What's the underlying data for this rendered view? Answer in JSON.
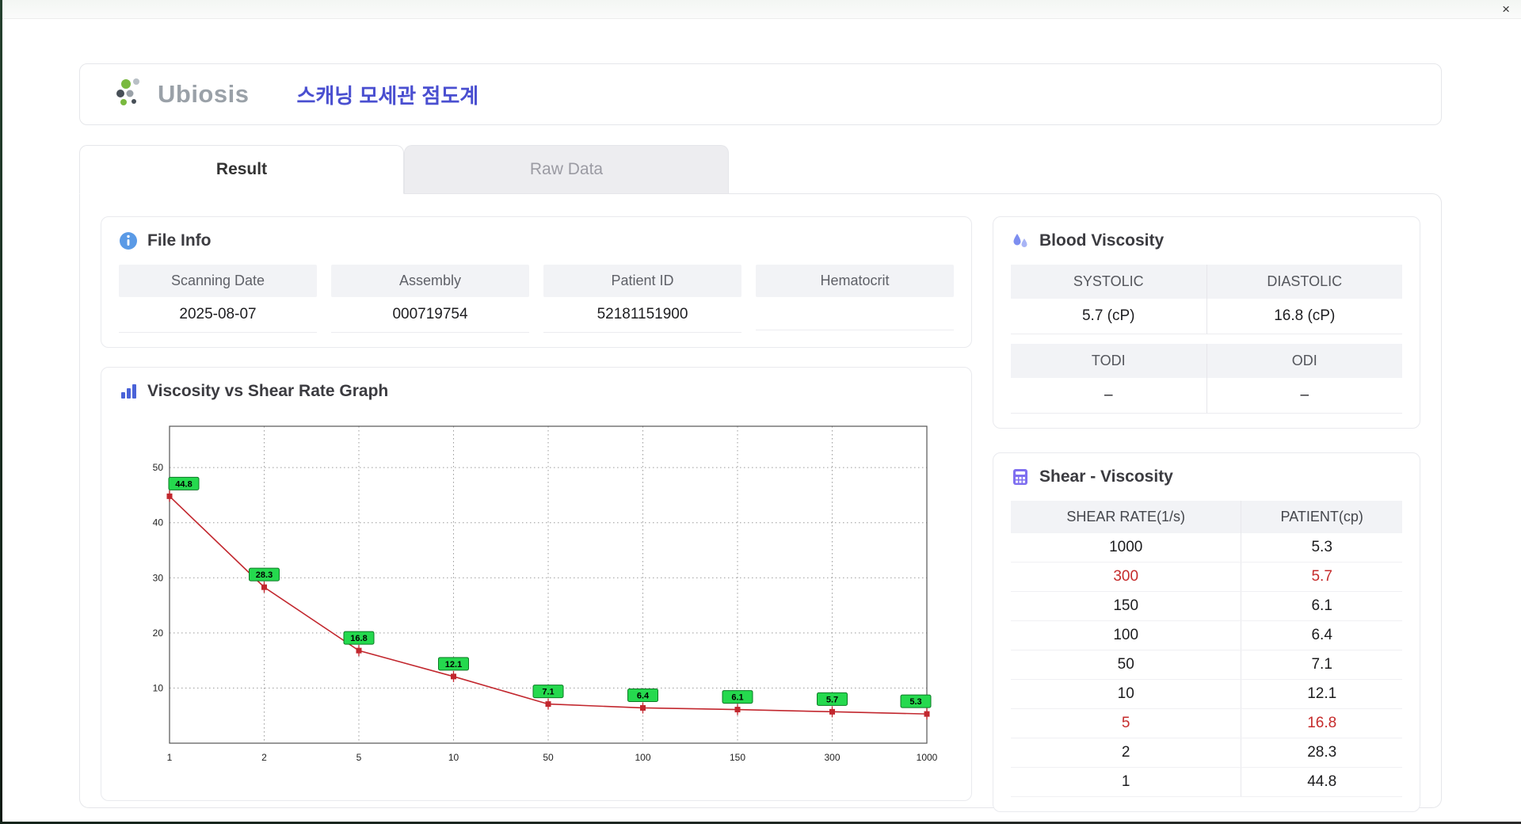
{
  "window": {
    "close_label": "×"
  },
  "header": {
    "logo_text": "Ubiosis",
    "title": "스캐닝 모세관 점도계"
  },
  "tabs": [
    {
      "label": "Result",
      "active": true
    },
    {
      "label": "Raw Data",
      "active": false
    }
  ],
  "file_info": {
    "title": "File Info",
    "fields": [
      {
        "label": "Scanning Date",
        "value": "2025-08-07"
      },
      {
        "label": "Assembly",
        "value": "000719754"
      },
      {
        "label": "Patient ID",
        "value": "52181151900"
      },
      {
        "label": "Hematocrit",
        "value": ""
      }
    ]
  },
  "blood_viscosity": {
    "title": "Blood Viscosity",
    "rows": [
      {
        "labels": [
          "SYSTOLIC",
          "DIASTOLIC"
        ],
        "values": [
          "5.7 (cP)",
          "16.8 (cP)"
        ]
      },
      {
        "labels": [
          "TODI",
          "ODI"
        ],
        "values": [
          "–",
          "–"
        ]
      }
    ]
  },
  "graph": {
    "title": "Viscosity vs Shear Rate Graph"
  },
  "chart_data": {
    "type": "line",
    "title": "Viscosity vs Shear Rate Graph",
    "x": [
      1,
      2,
      5,
      10,
      50,
      100,
      150,
      300,
      1000
    ],
    "x_tick_labels": [
      "1",
      "2",
      "5",
      "10",
      "50",
      "100",
      "150",
      "300",
      "1000"
    ],
    "values": [
      44.8,
      28.3,
      16.8,
      12.1,
      7.1,
      6.4,
      6.1,
      5.7,
      5.3
    ],
    "point_labels": [
      "44.8",
      "28.3",
      "16.8",
      "12.1",
      "7.1",
      "6.4",
      "6.1",
      "5.7",
      "5.3"
    ],
    "y_ticks": [
      10,
      20,
      30,
      40,
      50
    ],
    "ylim": [
      0,
      57.5
    ],
    "x_scale": "log-categorical",
    "grid": true,
    "legend": "none",
    "line_color": "#c2272e",
    "marker_color": "#c2272e",
    "label_fill": "#25d94e",
    "label_stroke": "#0b7a24"
  },
  "shear_table": {
    "title": "Shear - Viscosity",
    "columns": [
      "SHEAR RATE(1/s)",
      "PATIENT(cp)"
    ],
    "rows": [
      {
        "shear": "1000",
        "patient": "5.3",
        "highlight": false
      },
      {
        "shear": "300",
        "patient": "5.7",
        "highlight": true
      },
      {
        "shear": "150",
        "patient": "6.1",
        "highlight": false
      },
      {
        "shear": "100",
        "patient": "6.4",
        "highlight": false
      },
      {
        "shear": "50",
        "patient": "7.1",
        "highlight": false
      },
      {
        "shear": "10",
        "patient": "12.1",
        "highlight": false
      },
      {
        "shear": "5",
        "patient": "16.8",
        "highlight": true
      },
      {
        "shear": "2",
        "patient": "28.3",
        "highlight": false
      },
      {
        "shear": "1",
        "patient": "44.8",
        "highlight": false
      }
    ]
  },
  "colors": {
    "accent_blue": "#4a4fd0",
    "highlight_red": "#c52b2b",
    "point_green": "#25d94e",
    "line_red": "#c2272e"
  }
}
